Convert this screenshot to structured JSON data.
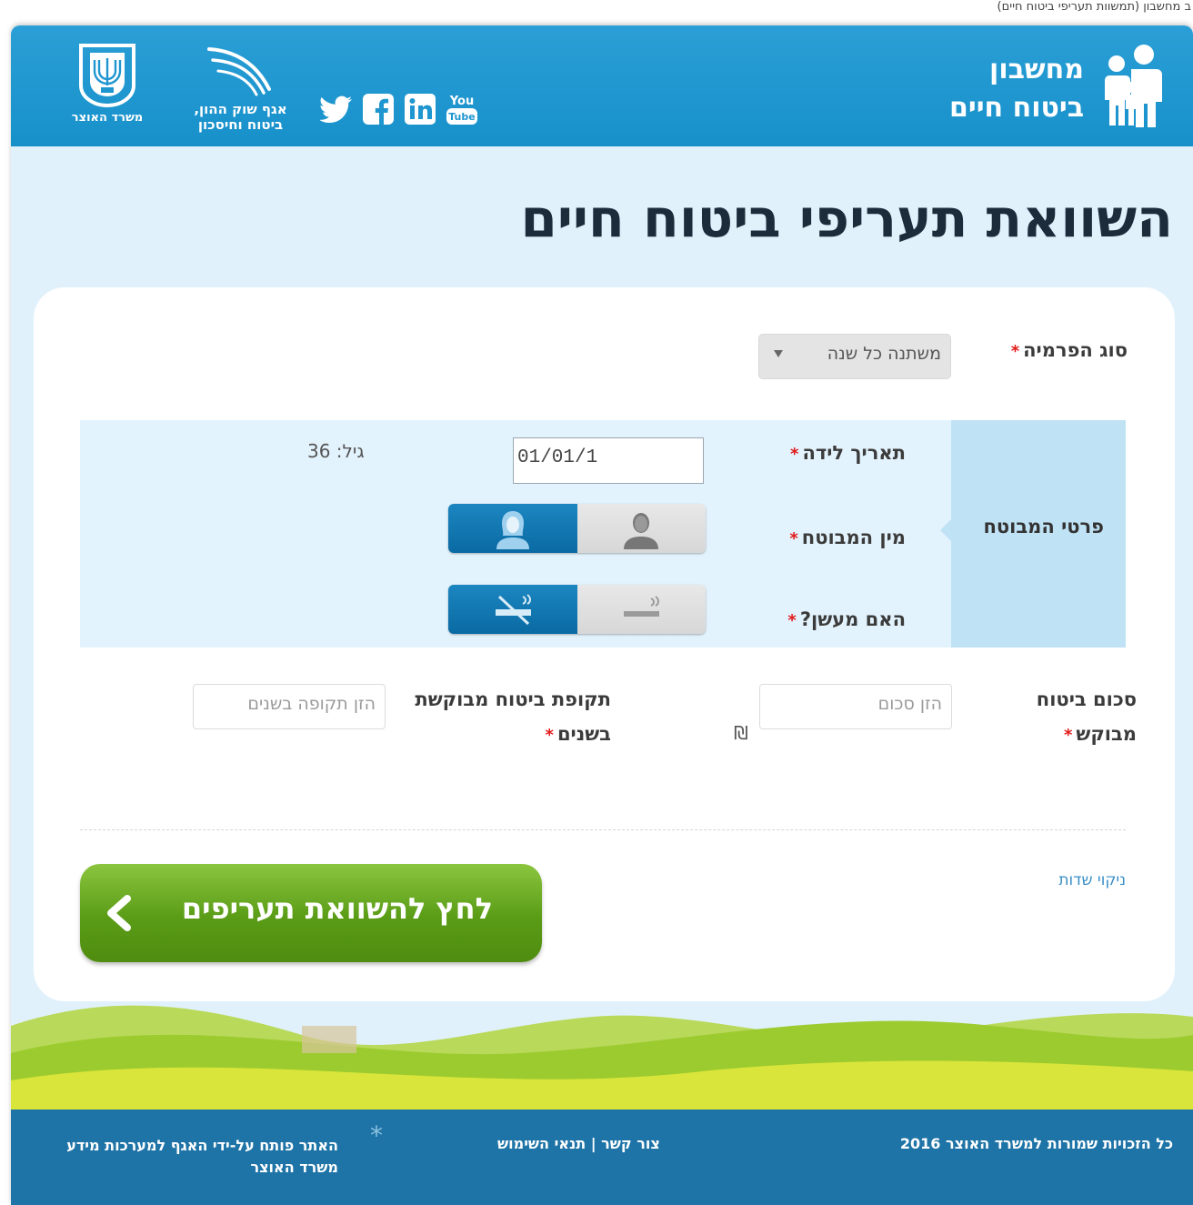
{
  "browser_caption": "ב מחשבון (תמשוות תעריפי ביטוח חיים)",
  "header": {
    "brand_line1": "מחשבון",
    "brand_line2": "ביטוח חיים",
    "ministry_label": "משרד האוצר",
    "division_line1": "אגף שוק ההון,",
    "division_line2": "ביטוח וחיסכון",
    "social": [
      "twitter-icon",
      "facebook-icon",
      "linkedin-icon",
      "youtube-icon"
    ],
    "youtube_top": "You",
    "youtube_bottom": "Tube"
  },
  "page_title": "השוואת תעריפי ביטוח חיים",
  "form": {
    "premium_type_label": "סוג הפרמיה",
    "premium_type_value": "משתנה כל שנה",
    "insured_section_label": "פרטי המבוטח",
    "birth_date_label": "תאריך לידה",
    "birth_date_value": "01/01/1",
    "age_text": "גיל: 36",
    "gender_label": "מין המבוטח",
    "gender_selected": "female",
    "smoker_label": "האם מעשן?",
    "smoker_selected": "non-smoker",
    "sum_label_line1": "סכום ביטוח",
    "sum_label_line2": "מבוקש",
    "sum_placeholder": "הזן סכום",
    "currency": "₪",
    "period_label_line1": "תקופת ביטוח מבוקשת",
    "period_label_line2": "בשנים",
    "period_placeholder": "הזן תקופה בשנים",
    "required_mark": "*",
    "clear_link": "ניקוי שדות",
    "submit_label": "לחץ להשוואת תעריפים"
  },
  "footer": {
    "copyright": "כל הזכויות שמורות למשרד האוצר 2016",
    "links": "צור קשר | תנאי השימוש",
    "developer_line1": "האתר פותח על-ידי האגף למערכות מידע",
    "developer_line2": "משרד האוצר",
    "star": "*"
  },
  "colors": {
    "header_blue": "#1f96d0",
    "active_toggle": "#0f74ad",
    "cta_green": "#5a9c16",
    "footer_blue": "#1f74a7",
    "page_bg": "#e1f1fc"
  }
}
